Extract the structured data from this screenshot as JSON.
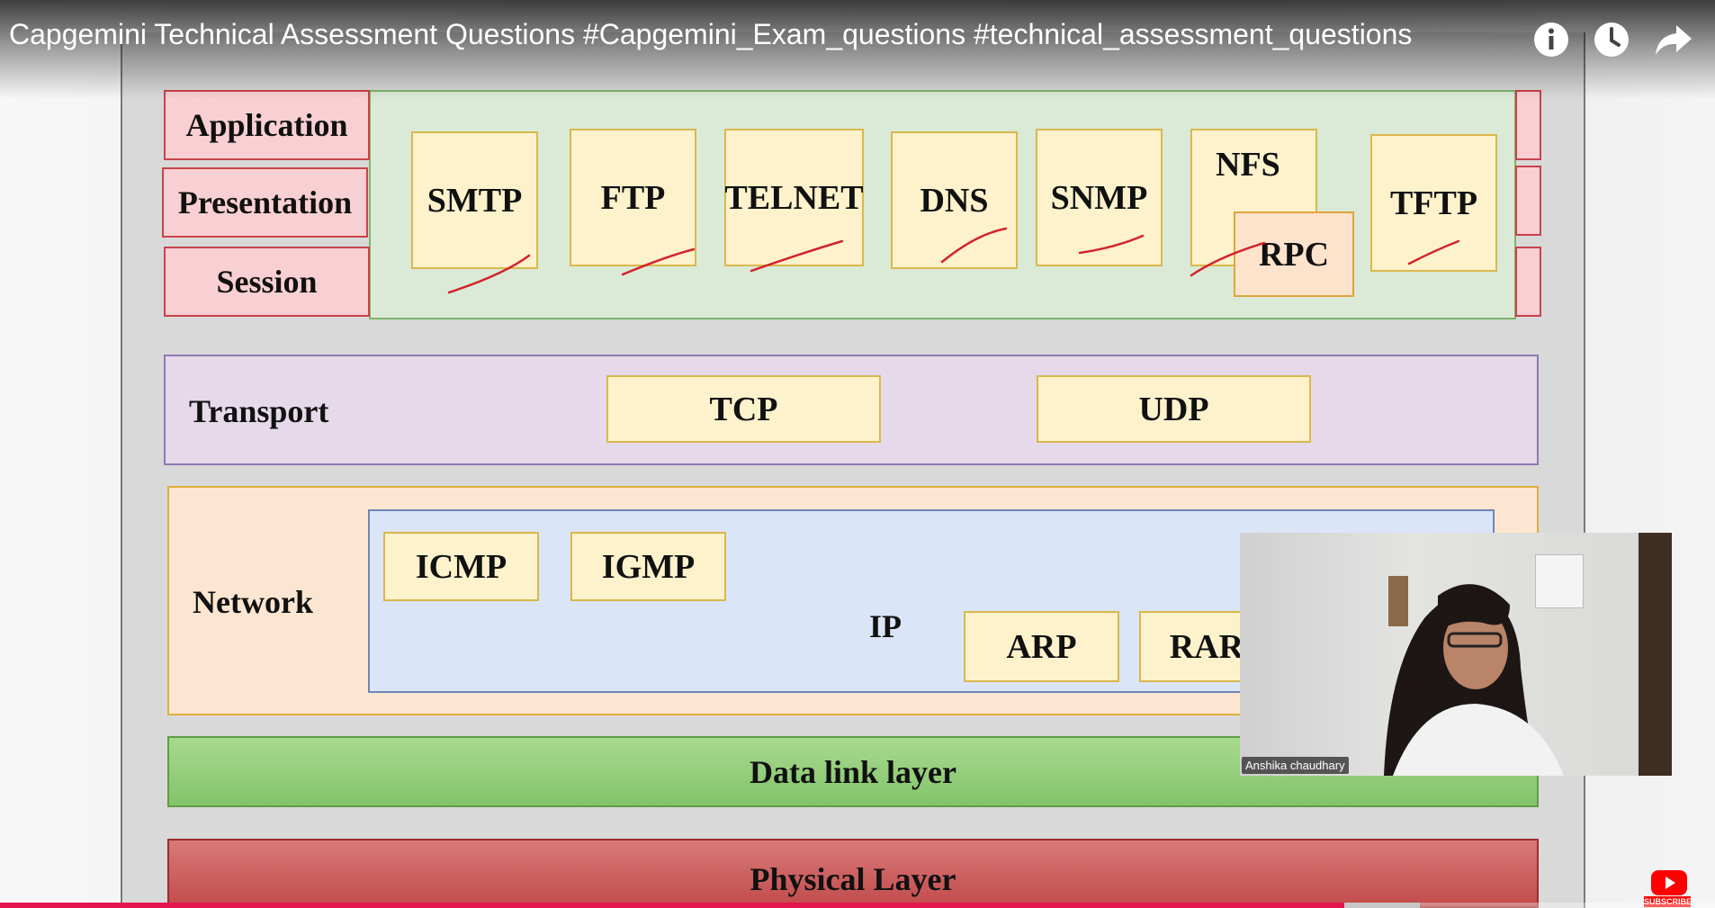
{
  "video": {
    "title": "Capgemini Technical Assessment Questions #Capgemini_Exam_questions #technical_assessment_questions",
    "progress": 0.784,
    "top_buttons": [
      "info-icon",
      "watch-later-icon",
      "share-icon"
    ]
  },
  "osi_layers": {
    "application": "Application",
    "presentation": "Presentation",
    "session": "Session",
    "transport": "Transport",
    "network": "Network",
    "datalink": "Data link layer",
    "physical": "Physical Layer"
  },
  "protocols": {
    "smtp": "SMTP",
    "ftp": "FTP",
    "telnet": "TELNET",
    "dns": "DNS",
    "snmp": "SNMP",
    "nfs": "NFS",
    "rpc": "RPC",
    "tftp": "TFTP",
    "tcp": "TCP",
    "udp": "UDP",
    "icmp": "ICMP",
    "igmp": "IGMP",
    "ip": "IP",
    "arp": "ARP",
    "rarp": "RARP"
  },
  "presenter": {
    "name": "Anshika chaudhary"
  },
  "subscribe": {
    "label": "SUBSCRIBE"
  },
  "colors": {
    "progress": "#e3144f",
    "youtube_red": "#ff0000"
  }
}
